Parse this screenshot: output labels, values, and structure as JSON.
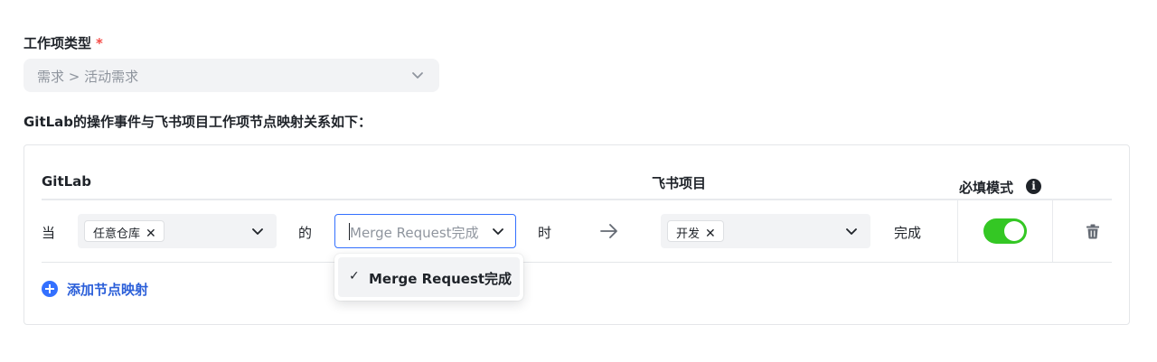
{
  "form": {
    "work_item_type_label": "工作项类型",
    "required_mark": "*",
    "work_item_type_value": "需求 > 活动需求",
    "mapping_description": "GitLab的操作事件与飞书项目工作项节点映射关系如下："
  },
  "mapping_table": {
    "col_gitlab": "GitLab",
    "col_feishu": "飞书项目",
    "col_required_mode": "必填模式",
    "rows": [
      {
        "prefix": "当",
        "repo_tag": "任意仓库",
        "connector": "的",
        "event_placeholder": "Merge Request完成",
        "suffix": "时",
        "node_tag": "开发",
        "status": "完成",
        "required_mode_on": true
      }
    ],
    "add_mapping_label": "添加节点映射"
  },
  "dropdown": {
    "options": [
      {
        "label": "Merge Request完成",
        "selected": true
      }
    ]
  },
  "colors": {
    "accent": "#3370ff",
    "toggle_on": "#34c724",
    "required": "#f54a45"
  },
  "icons": [
    "chevron-down-icon",
    "close-icon",
    "arrow-right-icon",
    "info-icon",
    "trash-icon",
    "plus-circle-icon",
    "check-icon"
  ]
}
